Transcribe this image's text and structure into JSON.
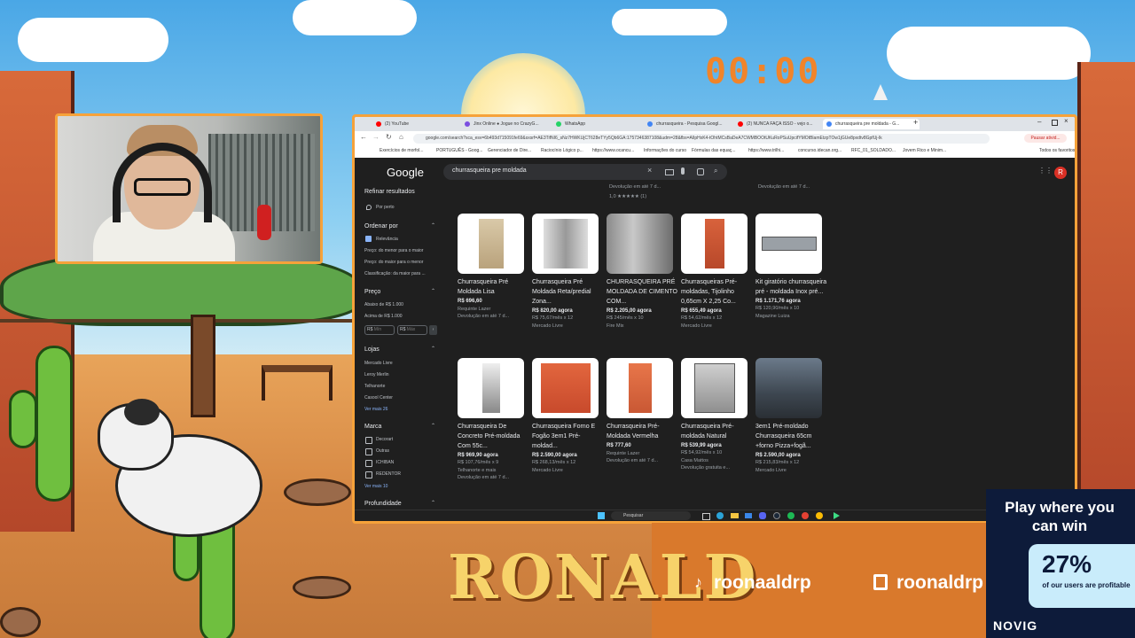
{
  "overlay": {
    "timer": "00:00",
    "streamer_name": "RONALD",
    "tiktok_handle": "roonaaldrp",
    "twitch_handle": "roonaldrp"
  },
  "ad": {
    "headline": "Play where you can win",
    "percent": "27%",
    "subtext": "of our users are profitable",
    "brand": "NOVIG"
  },
  "browser": {
    "tabs": [
      {
        "label": "(2) YouTube",
        "color": "#ff0000"
      },
      {
        "label": "Jinx Online ● Jogue no CrazyG...",
        "color": "#7b4fe0"
      },
      {
        "label": "WhatsApp",
        "color": "#25d366"
      },
      {
        "label": "churrasqueira - Pesquisa Googl...",
        "color": "#4285f4"
      },
      {
        "label": "(2) NUNCA FAÇA ISSO - vejo o...",
        "color": "#ff0000"
      },
      {
        "label": "churrasqueira pre moldada - G...",
        "color": "#4285f4"
      }
    ],
    "url": "google.com/search?sca_esv=6b493d715091fe69&sxsrf=AE3TifNI6_sNz7HWKUjCT628eTYy5Qb6GA:1757346387108&udm=28&fbs=AIlpHxK4-tOhtMCsBaDeA7CWMBOOtUKuRoPSuUpcifYMOtBlamEtzpTOw1jGUe8pxdtv8GpfUj-lk",
    "profile_label": "Pausar ativid...",
    "bookmarks": [
      "Exercícios de morfol...",
      "PORTUGUÊS - Goog...",
      "Gerenciador de Dire...",
      "Raciocínio Lógico p...",
      "https://www.ocancu...",
      "Informações do curso",
      "Fórmulas das equaç...",
      "https://www.trilhi...",
      "concurso.idecan.org...",
      "RFC_01_SOLDADO...",
      "Jovem Rico e Minim..."
    ],
    "all_favorites": "Todos os favoritos",
    "google_logo": "Google",
    "search_query": "churrasqueira pre moldada",
    "avatar_letter": "R"
  },
  "sidebar": {
    "refine": "Refinar resultados",
    "nearby": "Por perto",
    "sort_heading": "Ordenar por",
    "sort_items": [
      "Relevância",
      "Preço: do menor para o maior",
      "Preço: do maior para o menor",
      "Classificação: da maior para ..."
    ],
    "price_heading": "Preço",
    "price_items": [
      "Abaixo de R$ 1.000",
      "Acima de R$ 1.000"
    ],
    "price_min_prefix": "R$",
    "price_min_placeholder": "Mín",
    "price_max_prefix": "R$",
    "price_max_placeholder": "Máx",
    "stores_heading": "Lojas",
    "stores_items": [
      "Mercado Livre",
      "Leroy Merlin",
      "Telhanorte",
      "Casool Center"
    ],
    "stores_more": "Ver mais 26",
    "brand_heading": "Marca",
    "brand_items": [
      "Decorart",
      "Outras",
      "ICHIBAN",
      "REDENTOR"
    ],
    "brand_more": "Ver mais 10",
    "depth_heading": "Profundidade"
  },
  "results_top": {
    "left_snippet": "Devolução em até 7 d...",
    "left_rating": "1,0 ★★★★★ (1)",
    "right_snippet": "Devolução em até 7 d..."
  },
  "products_row1": [
    {
      "title": "Churrasqueira Pré Moldada Lisa",
      "price": "R$ 696,60",
      "installment": "",
      "seller": "Requinte Lazer",
      "extra": "Devolução em até 7 d..."
    },
    {
      "title": "Churrasqueira Pré Moldada Reta/predial Zona...",
      "price": "R$ 820,00 agora",
      "installment": "R$ 75,67/mês x 12",
      "seller": "Mercado Livre",
      "extra": ""
    },
    {
      "title": "CHURRASQUEIRA PRÉ MOLDADA DE CIMENTO COM...",
      "price": "R$ 2.205,00 agora",
      "installment": "R$ 245/mês x 10",
      "seller": "Fire Mix",
      "extra": ""
    },
    {
      "title": "Churrasqueiras Pré-moldadas, Tijolinho 0,65cm X 2,25 Co...",
      "price": "R$ 655,49 agora",
      "installment": "R$ 54,62/mês x 12",
      "seller": "Mercado Livre",
      "extra": ""
    },
    {
      "title": "Kit giratório churrasqueira pré - moldada Inox pré...",
      "price": "R$ 1.171,76 agora",
      "installment": "R$ 120,90/mês x 10",
      "seller": "Magazine Luiza",
      "extra": ""
    }
  ],
  "products_row2": [
    {
      "title": "Churrasqueira De Concreto Pré-moldada Com 55c...",
      "price": "R$ 969,90 agora",
      "installment": "R$ 107,76/mês x 9",
      "seller": "Telhanorte e mais",
      "extra": "Devolução em até 7 d..."
    },
    {
      "title": "Churrasqueira Forno E Fogão 3em1 Pré-moldad...",
      "price": "R$ 2.590,00 agora",
      "installment": "R$ 268,13/mês x 12",
      "seller": "Mercado Livre",
      "extra": ""
    },
    {
      "title": "Churrasqueira Pré-Moldada Vermelha",
      "price": "R$ 777,60",
      "installment": "",
      "seller": "Requinte Lazer",
      "extra": "Devolução em até 7 d..."
    },
    {
      "title": "Churrasqueira Pré-moldada Natural",
      "price": "R$ 539,99 agora",
      "installment": "R$ 54,92/mês x 10",
      "seller": "Casa Mattos",
      "extra": "Devolução gratuita e..."
    },
    {
      "title": "3em1 Pré-moldado Churrasqueira 65cm +forno Pizza+fogã...",
      "price": "R$ 2.590,00 agora",
      "installment": "R$ 215,83/mês x 12",
      "seller": "Mercado Livre",
      "extra": ""
    }
  ],
  "taskbar": {
    "search_label": "Pesquisar"
  }
}
